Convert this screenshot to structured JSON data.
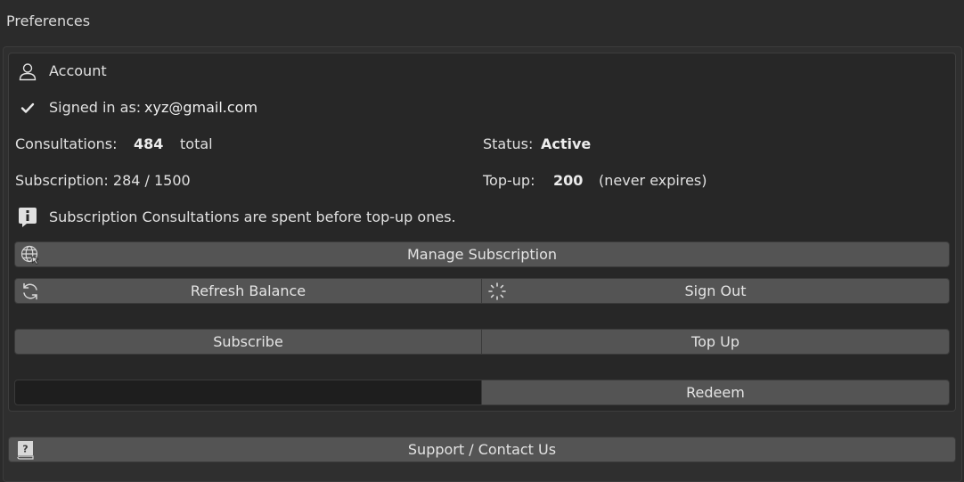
{
  "window": {
    "title": "Preferences"
  },
  "account": {
    "heading": "Account",
    "signed_in_label": "Signed in as:",
    "email": "xyz@gmail.com",
    "consultations_label": "Consultations:",
    "consultations_value": "484",
    "consultations_suffix": "total",
    "status_label": "Status:",
    "status_value": "Active",
    "subscription_text": "Subscription: 284 / 1500",
    "topup_label": "Top-up:",
    "topup_value": "200",
    "topup_suffix": "(never expires)",
    "info_text": "Subscription Consultations are spent before top-up ones."
  },
  "buttons": {
    "manage_subscription": "Manage Subscription",
    "refresh_balance": "Refresh Balance",
    "sign_out": "Sign Out",
    "subscribe": "Subscribe",
    "top_up": "Top Up",
    "redeem": "Redeem",
    "support": "Support / Contact Us"
  },
  "redeem_input": {
    "value": "",
    "placeholder": ""
  },
  "icons": {
    "account": "user-icon",
    "signed_in": "checkmark-icon",
    "info": "info-icon",
    "manage": "globe-cursor-icon",
    "refresh": "refresh-icon",
    "sign_out": "loading-spinner-icon",
    "support": "help-book-icon"
  }
}
